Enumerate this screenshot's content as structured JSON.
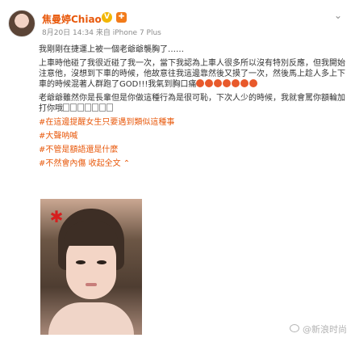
{
  "post": {
    "username": "焦曼婷Chiao",
    "badge": "V",
    "meta": "8月20日 14:34 来自 iPhone 7 Plus",
    "paragraphs": [
      "我剛剛在捷運上被一個老爺爺襲胸了……",
      "上車時他碰了我很近碰了我一次，當下我認為上車人很多所以沒有特別反應，但我開始注意他，沒想到下車的時候，他故意往我這邊靠然後又摸了一次，然後馬上趁人多上下車的時候混著人群跑了GOD!!!我氣到胸口痛",
      "老爺爺雖然你是長輩但是你做這種行為是很可恥，下次人少的時候，我就會罵你額輪加打你哦"
    ],
    "topics": [
      "#在這邊提醒女生只要遇到類似這種事",
      "#大聲呐喊",
      "#不管是額語還是什麼",
      "#不然會內傷"
    ],
    "collapse_label": "收起全文",
    "watermark": "@新浪时尚"
  },
  "colors": {
    "accent": "#e8590c",
    "meta": "#8c8c8c",
    "text": "#333333"
  }
}
